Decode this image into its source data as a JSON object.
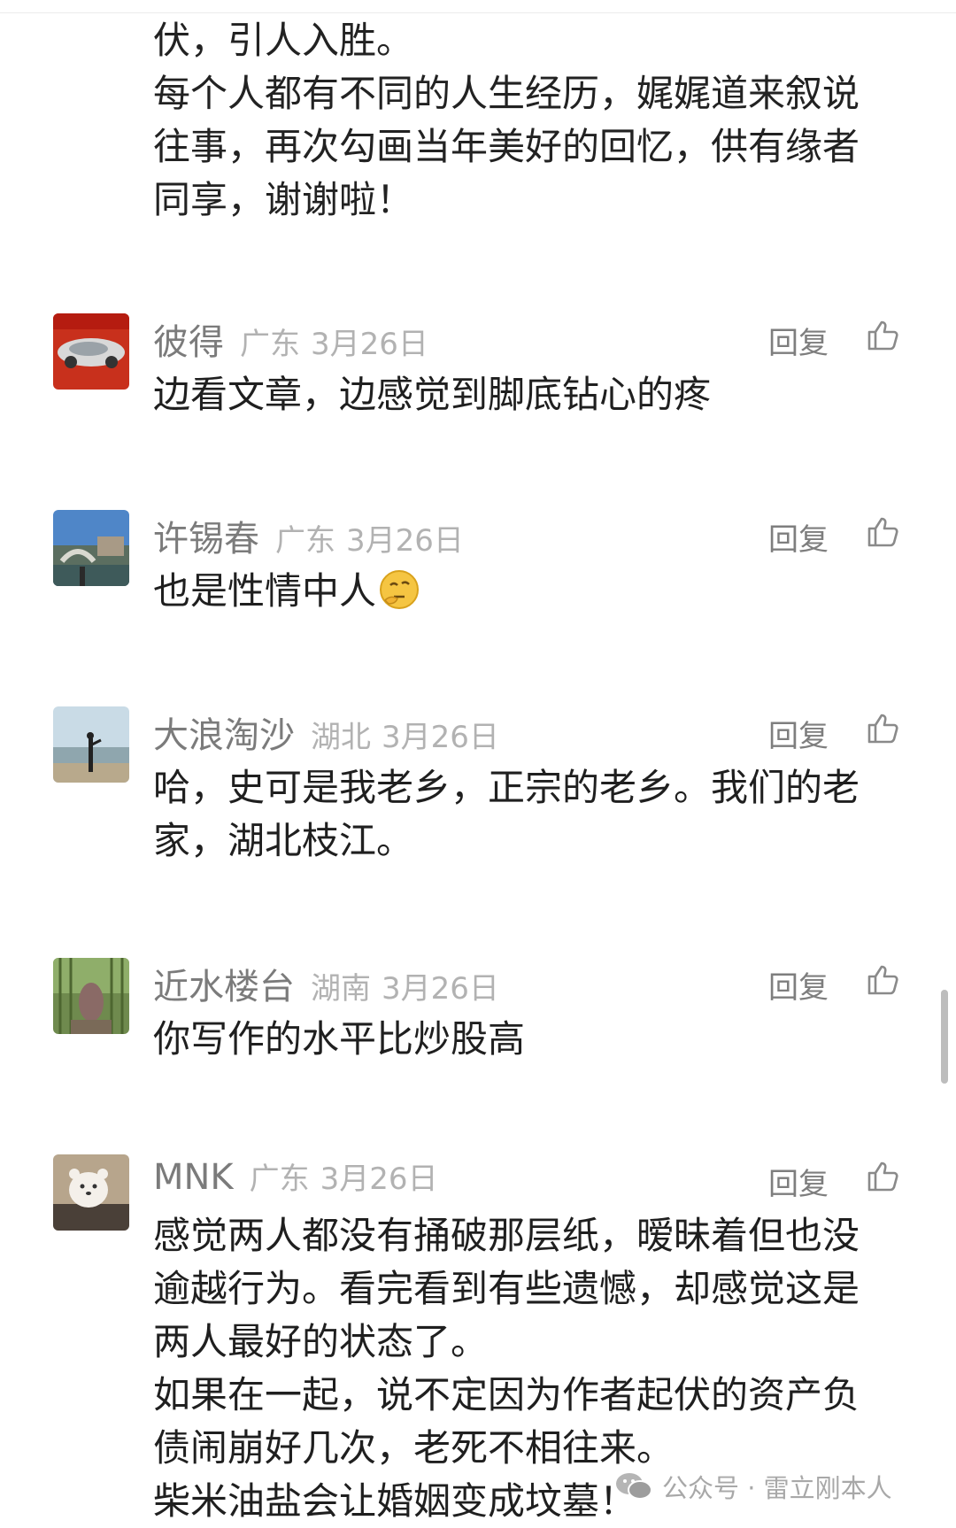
{
  "intro": {
    "lines": [
      "伏，引人入胜。",
      "每个人都有不同的人生经历，娓娓道来叙说",
      "往事，再次勾画当年美好的回忆，供有缘者",
      "同享，谢谢啦！"
    ]
  },
  "reply_label": "回复",
  "comments": [
    {
      "name": "彼得",
      "location": "广东",
      "date": "3月26日",
      "lines": [
        "边看文章，边感觉到脚底钻心的疼"
      ]
    },
    {
      "name": "许锡春",
      "location": "广东",
      "date": "3月26日",
      "lines": [
        "也是性情中人"
      ],
      "emoji": "thinking-face-icon"
    },
    {
      "name": "大浪淘沙",
      "location": "湖北",
      "date": "3月26日",
      "lines": [
        "哈，史可是我老乡，正宗的老乡。我们的老",
        "家，湖北枝江。"
      ]
    },
    {
      "name": "近水楼台",
      "location": "湖南",
      "date": "3月26日",
      "lines": [
        "你写作的水平比炒股高"
      ]
    },
    {
      "name": "MNK",
      "location": "广东",
      "date": "3月26日",
      "lines": [
        "感觉两人都没有捅破那层纸，暧昧着但也没",
        "逾越行为。看完看到有些遗憾，却感觉这是",
        "两人最好的状态了。",
        "如果在一起，说不定因为作者起伏的资产负",
        "债闹崩好几次，老死不相往来。",
        "柴米油盐会让婚姻变成坟墓！"
      ]
    }
  ],
  "watermark": {
    "text": "公众号 · 雷立刚本人",
    "icon": "wechat-icon"
  },
  "colors": {
    "name": "#7b7b7b",
    "meta": "#b2b2b2",
    "body": "#1f1f1f",
    "reply": "#7e7e7e"
  }
}
